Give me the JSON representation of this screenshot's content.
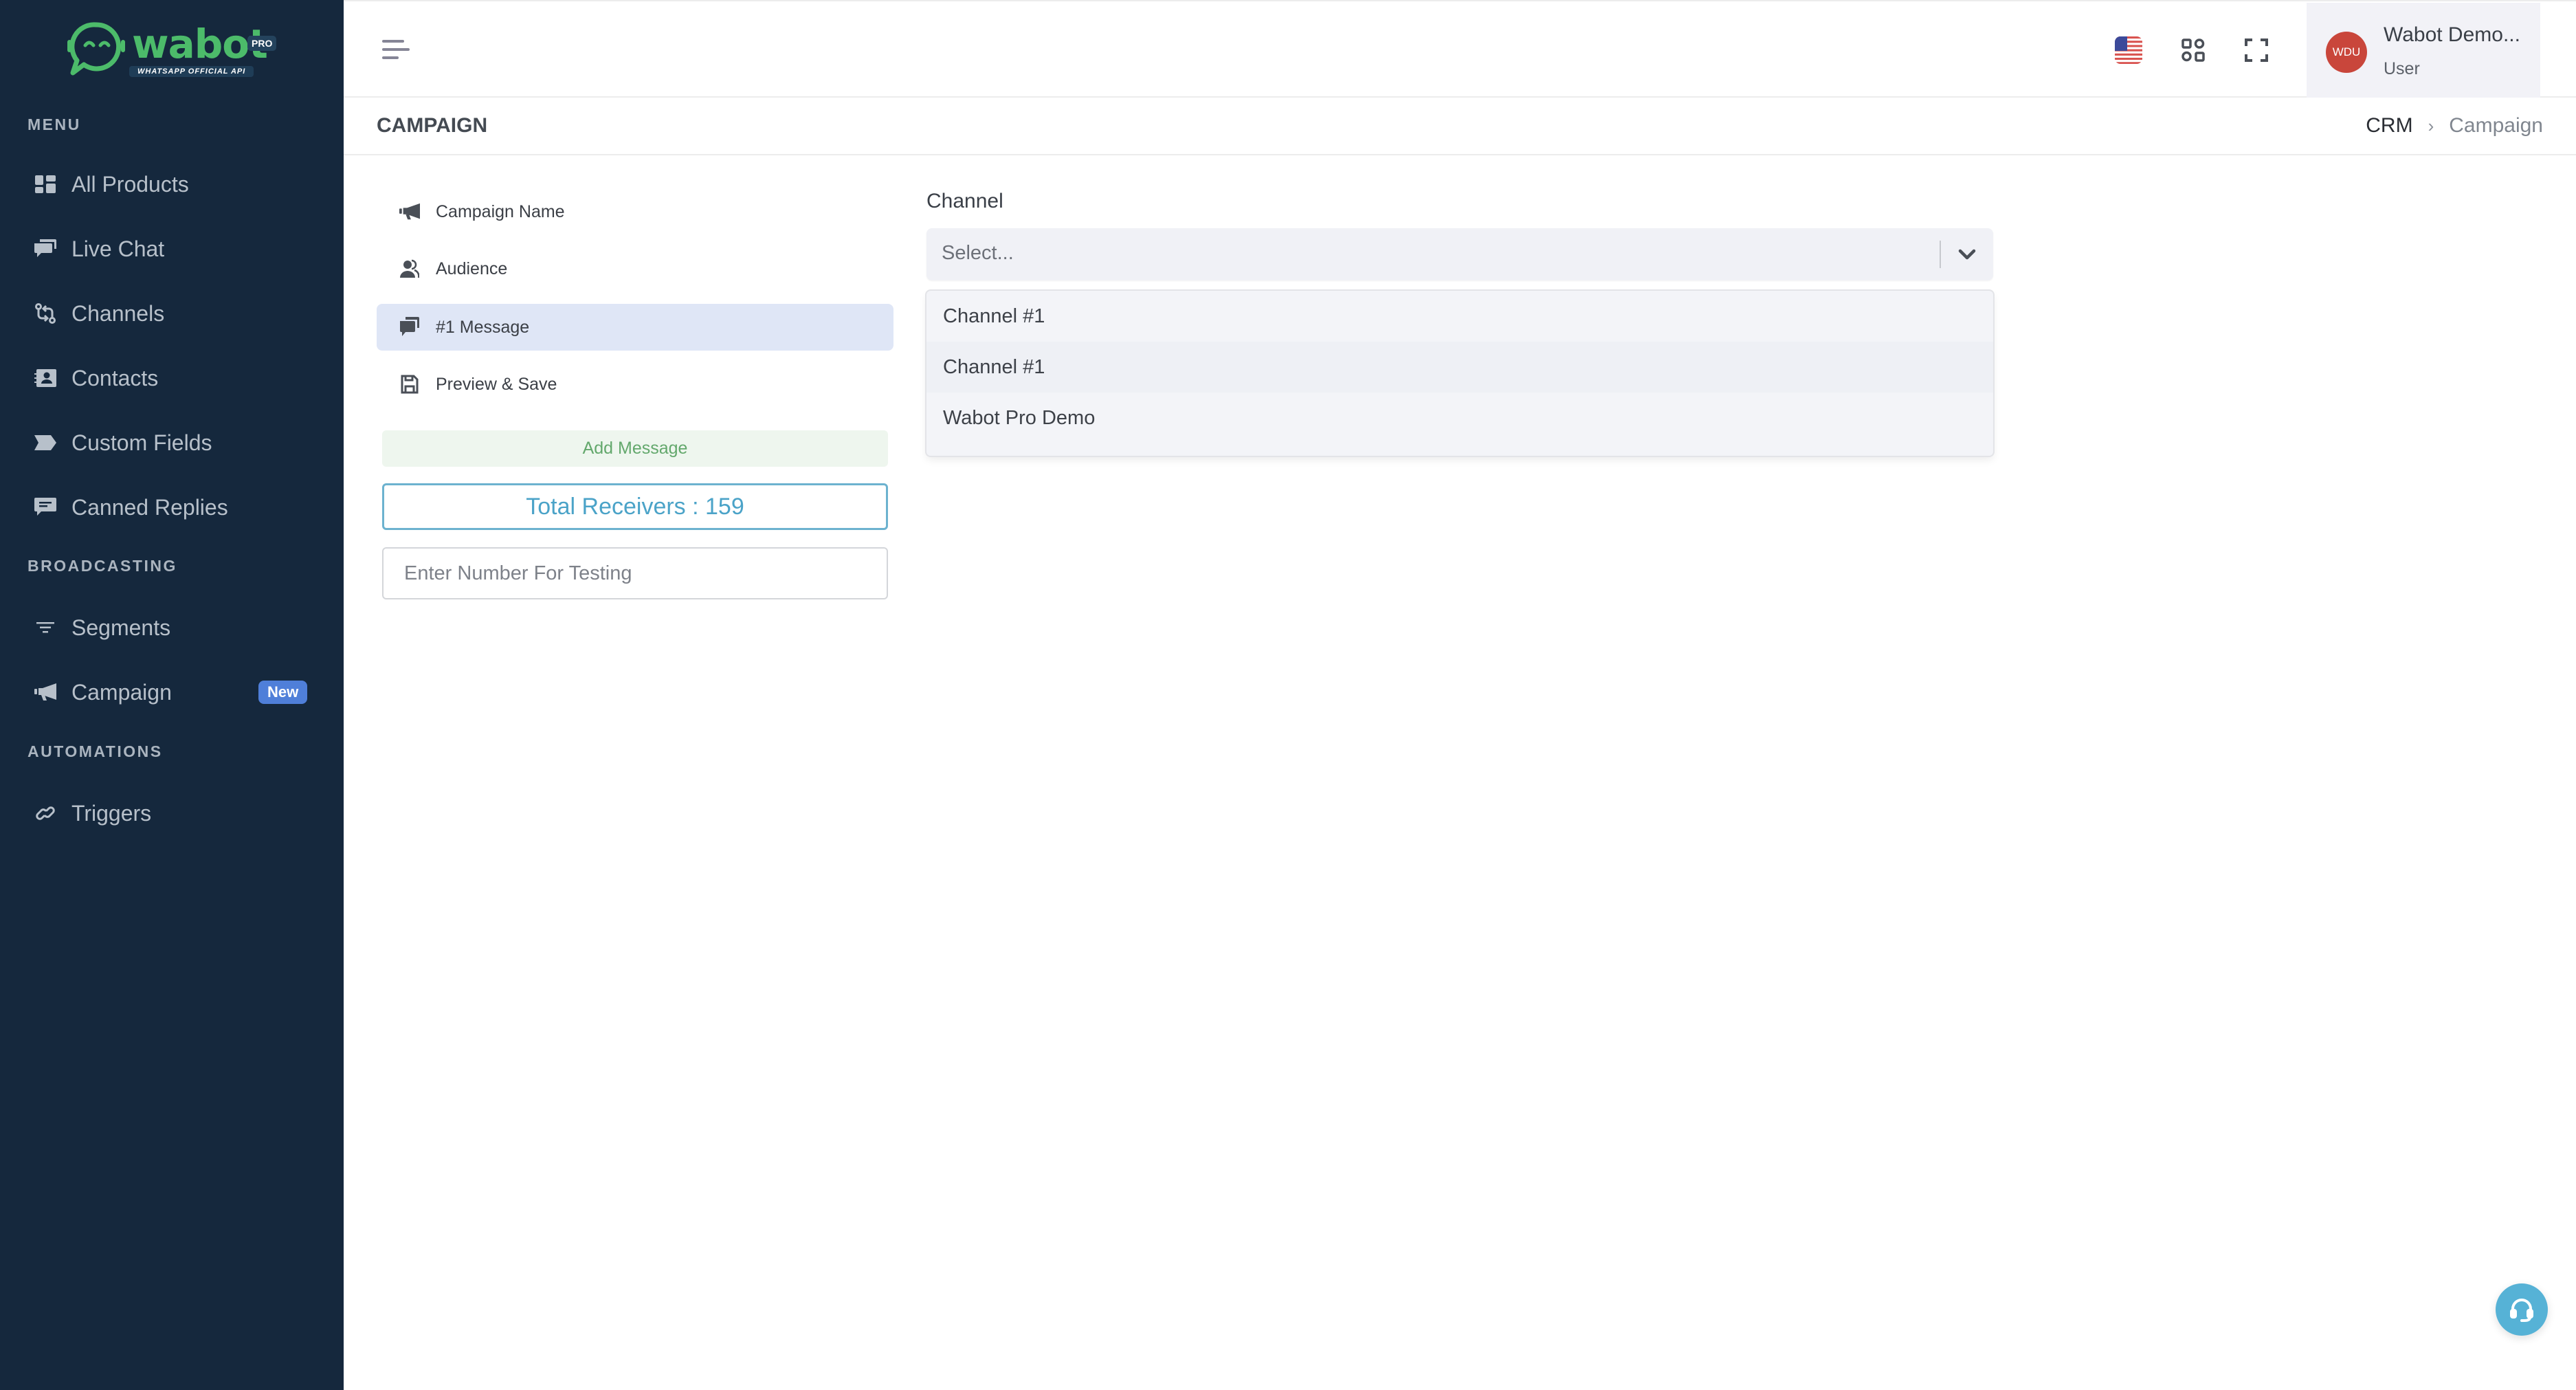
{
  "brand": {
    "name": "wabot",
    "tag": "PRO",
    "subtitle": "WHATSAPP OFFICIAL API",
    "color": "#4cbb6a"
  },
  "sidebar": {
    "sections": [
      {
        "title": "MENU",
        "items": [
          {
            "label": "All Products",
            "icon": "grid-icon"
          },
          {
            "label": "Live Chat",
            "icon": "chat-bubbles-icon"
          },
          {
            "label": "Channels",
            "icon": "git-compare-icon"
          },
          {
            "label": "Contacts",
            "icon": "contact-card-icon"
          },
          {
            "label": "Custom Fields",
            "icon": "tag-icon"
          },
          {
            "label": "Canned Replies",
            "icon": "message-text-icon"
          }
        ]
      },
      {
        "title": "BROADCASTING",
        "items": [
          {
            "label": "Segments",
            "icon": "filter-icon"
          },
          {
            "label": "Campaign",
            "icon": "megaphone-icon",
            "badge": "New"
          }
        ]
      },
      {
        "title": "AUTOMATIONS",
        "items": [
          {
            "label": "Triggers",
            "icon": "link-icon"
          }
        ]
      }
    ]
  },
  "topbar": {
    "language_icon": "us-flag-icon",
    "apps_icon": "apps-grid-icon",
    "fullscreen_icon": "fullscreen-icon",
    "user": {
      "initials": "WDU",
      "name": "Wabot Demo...",
      "role": "User",
      "avatar_color": "#c9463b"
    }
  },
  "page": {
    "title": "CAMPAIGN",
    "breadcrumb": [
      "CRM",
      "Campaign"
    ]
  },
  "steps": [
    {
      "label": "Campaign Name",
      "icon": "megaphone-icon",
      "active": false
    },
    {
      "label": "Audience",
      "icon": "users-icon",
      "active": false
    },
    {
      "label": "#1 Message",
      "icon": "chat-bubbles-icon",
      "active": true
    },
    {
      "label": "Preview & Save",
      "icon": "save-icon",
      "active": false
    }
  ],
  "actions": {
    "add_message": "Add Message",
    "total_receivers_label": "Total Receivers : 159",
    "total_receivers": 159,
    "test_number_placeholder": "Enter Number For Testing",
    "test_number_value": ""
  },
  "channel": {
    "label": "Channel",
    "placeholder": "Select...",
    "options": [
      "Channel #1",
      "Channel #1",
      "Wabot Pro Demo"
    ],
    "expanded": true
  },
  "support_icon": "headset-icon"
}
